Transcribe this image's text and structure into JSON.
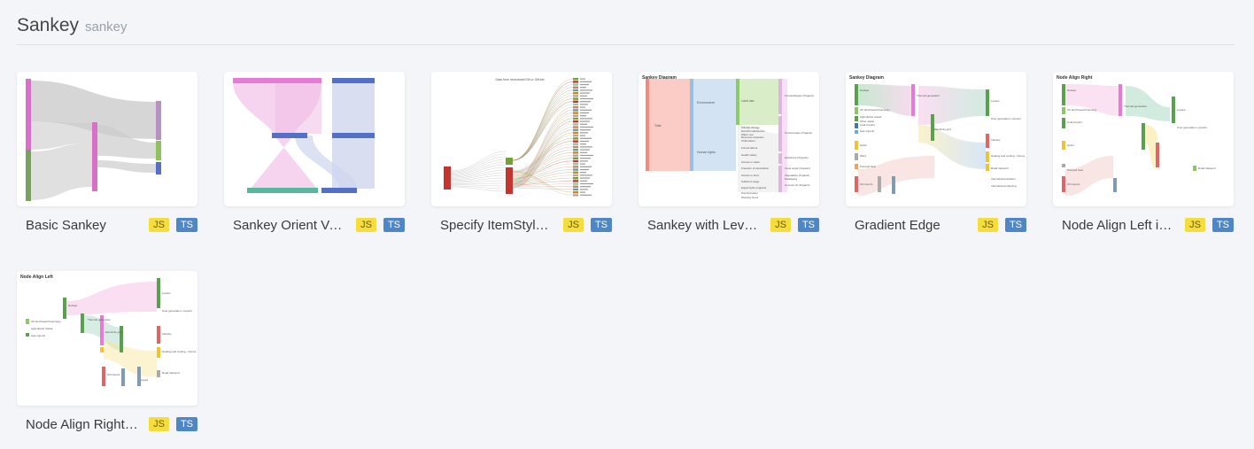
{
  "header": {
    "title": "Sankey",
    "subtitle": "sankey"
  },
  "badges": {
    "js": "JS",
    "ts": "TS"
  },
  "cards": [
    {
      "name": "Basic Sankey"
    },
    {
      "name": "Sankey Orient Ve..."
    },
    {
      "name": "Specify ItemStyle ..."
    },
    {
      "name": "Sankey with Level..."
    },
    {
      "name": "Gradient Edge"
    },
    {
      "name": "Node Align Left in..."
    },
    {
      "name": "Node Align Right i..."
    }
  ],
  "thumb_text": {
    "level_title": "Sankey Diagram",
    "gradient_title": "Sankey Diagram",
    "align_right_title": "Node Align Right",
    "align_left_title": "Node Align Left",
    "itemstyle_title": "Data from neurotonic/GitI or GitHub",
    "level_labels": [
      "Total",
      "Environment",
      "Human rights",
      "Land use",
      "Climate change",
      "Harmful substances",
      "Water use",
      "Resource depletion",
      "Child labour",
      "Forced labour",
      "Health safety",
      "Access to water",
      "Freedom of association",
      "Access to land",
      "Sufficient wage",
      "Equal rights migrants",
      "Discrimination",
      "Working hours",
      "Carrots/Apples (Organic)",
      "Cocoa beans (Organic)",
      "Hazelnuts (Organic)",
      "Cane sugar (Organic)",
      "Vegetables (Organic)",
      "Packaging",
      "Coconut oil (Organic)"
    ],
    "energy_labels": [
      "Nuclear",
      "UK land based bioenergy",
      "Agricultural 'waste'",
      "Other waste",
      "Marine algae",
      "Coal imports",
      "Coal reserves",
      "Gas imports",
      "Gas reserves",
      "Biomass imports",
      "Hydro",
      "Wind",
      "Wave",
      "Tidal",
      "Solar PV",
      "Solar Thermal",
      "Pumped heat",
      "Oil imports",
      "Oil reserves",
      "Bio-conversion",
      "Solid",
      "Liquid",
      "Gas",
      "Coal",
      "Thermal generation",
      "Electricity grid",
      "H2 conversion",
      "District heating",
      "Losses",
      "Over generation / exports",
      "Lighting & appliances - homes",
      "Lighting & appliances - commercial",
      "Industry",
      "Heating and cooling - homes",
      "Heating and cooling - commercial",
      "Road transport",
      "International aviation",
      "International shipping",
      "National navigation",
      "Domestic aviation",
      "Agriculture",
      "Rail transport",
      "H2"
    ]
  }
}
